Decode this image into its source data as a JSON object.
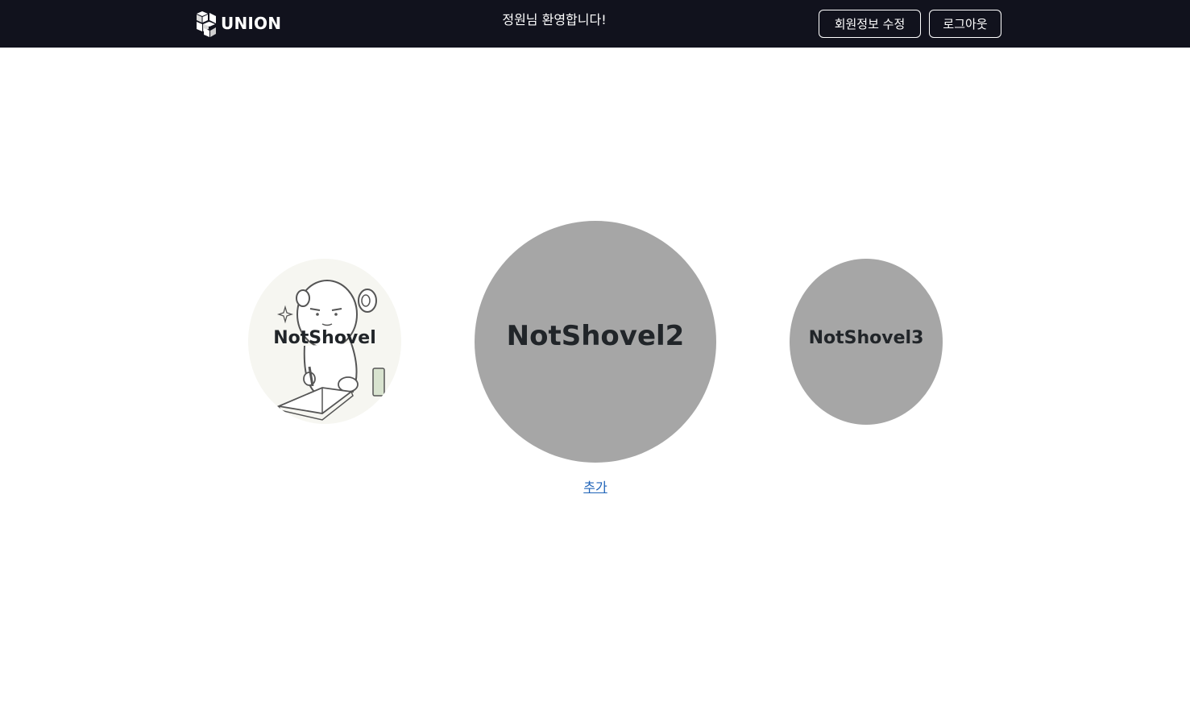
{
  "header": {
    "brand": "UNION",
    "brand_icon": "cubes-logo-icon",
    "welcome": "정원님 환영합니다!",
    "edit_profile_label": "회원정보 수정",
    "logout_label": "로그아웃",
    "background_color": "#11121d"
  },
  "main": {
    "items": [
      {
        "label": "NotShovel",
        "image": "character-reading-illustration"
      },
      {
        "label": "NotShovel2"
      },
      {
        "label": "NotShovel3"
      }
    ],
    "circle_color": "#a6a6a6",
    "add_link_label": "추가",
    "link_color": "#1f63b8"
  }
}
